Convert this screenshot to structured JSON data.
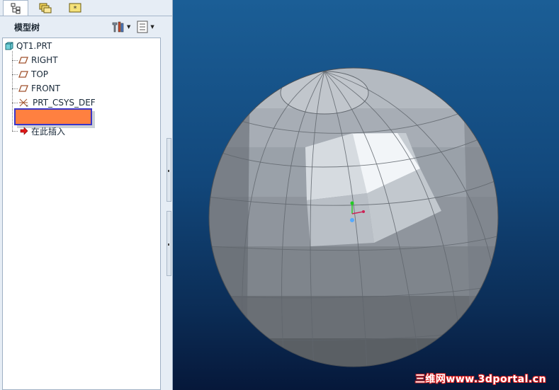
{
  "navigator": {
    "tabs": [
      {
        "name": "model-tree-tab",
        "active": true
      },
      {
        "name": "folder-browser-tab",
        "active": false
      },
      {
        "name": "favorites-tab",
        "active": false
      }
    ],
    "title": "模型树"
  },
  "tree": {
    "root": "QT1.PRT",
    "items": [
      {
        "label": "RIGHT",
        "icon": "datum-plane-icon"
      },
      {
        "label": "TOP",
        "icon": "datum-plane-icon"
      },
      {
        "label": "FRONT",
        "icon": "datum-plane-icon"
      },
      {
        "label": "PRT_CSYS_DEF",
        "icon": "coordinate-system-icon"
      }
    ],
    "selected_feature_label": "",
    "insert_here": "在此插入"
  },
  "viewport": {
    "model": "faceted-sphere",
    "watermark": "三维网www.3dportal.cn"
  },
  "colors": {
    "selection_fill": "#ff8040",
    "selection_border": "#3a36c8",
    "viewport_top": "#1b5e96",
    "viewport_bottom": "#06183a"
  }
}
